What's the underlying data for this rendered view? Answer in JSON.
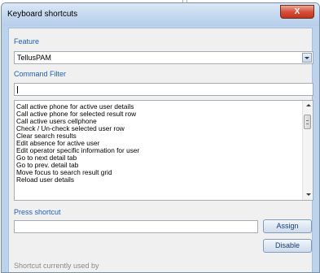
{
  "window": {
    "title": "Keyboard shortcuts",
    "close_label": "X"
  },
  "feature": {
    "label": "Feature",
    "selected": "TellusPAM"
  },
  "filter": {
    "label": "Command Filter",
    "value": ""
  },
  "commands": [
    "Call active phone for active user details",
    "Call active phone for selected result row",
    "Call active users cellphone",
    "Check / Un-check selected user row",
    "Clear search results",
    "Edit absence for active user",
    "Edit operator specific information for user",
    "Go to next detail tab",
    "Go to prev. detail tab",
    "Move focus to search result grid",
    "Reload user details"
  ],
  "shortcut": {
    "label": "Press shortcut",
    "value": "",
    "assign_label": "Assign",
    "disable_label": "Disable"
  },
  "used_by": {
    "label": "Shortcut currently used by"
  }
}
